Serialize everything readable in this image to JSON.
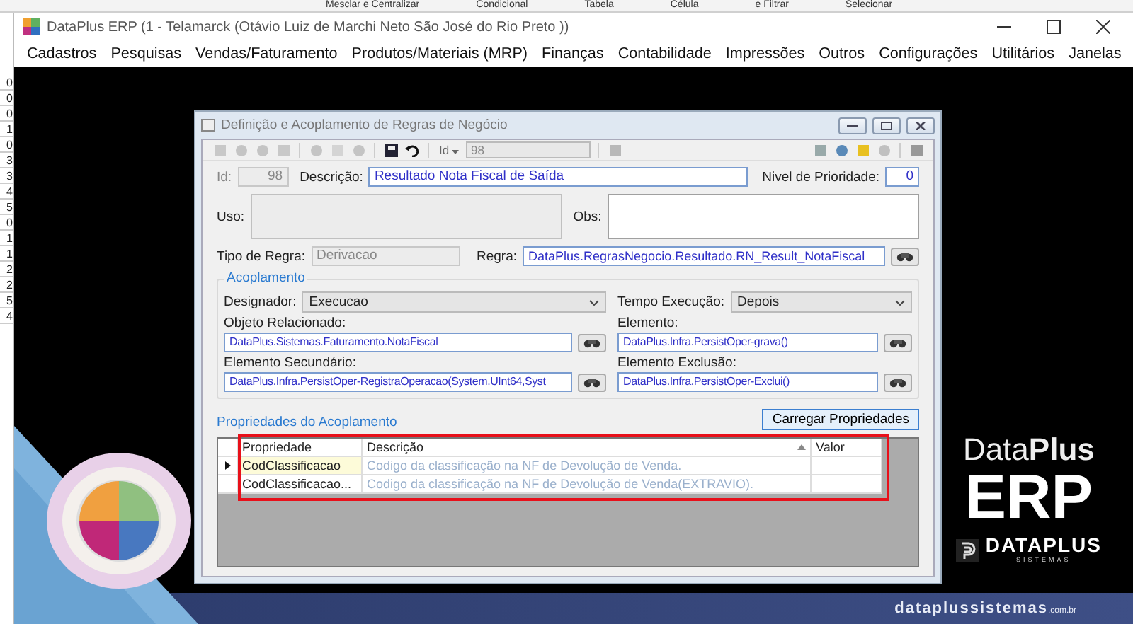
{
  "excel_ribbon": {
    "labels": [
      "Mesclar e Centralizar",
      "Condicional",
      "Tabela",
      "Célula",
      "e Filtrar",
      "Selecionar"
    ]
  },
  "excel_cells": [
    "0",
    "0",
    "0",
    "1",
    "0",
    "3",
    "3",
    "4",
    "5",
    "0",
    "1",
    "1",
    "2",
    "2",
    "5",
    "4"
  ],
  "window": {
    "title": "DataPlus ERP (1 - Telamarck  (Otávio Luiz de Marchi Neto São José do Rio Preto ))"
  },
  "menu": [
    "Cadastros",
    "Pesquisas",
    "Vendas/Faturamento",
    "Produtos/Materiais (MRP)",
    "Finanças",
    "Contabilidade",
    "Impressões",
    "Outros",
    "Configurações",
    "Utilitários",
    "Janelas"
  ],
  "dialog": {
    "title": "Definição e Acoplamento de Regras de Negócio",
    "toolbar": {
      "id_label": "Id",
      "id_value": "98"
    },
    "id": {
      "label": "Id:",
      "value": "98",
      "disabled": true
    },
    "descricao": {
      "label": "Descrição:",
      "value": "Resultado Nota Fiscal de Saída",
      "disabled": false
    },
    "prioridade": {
      "label": "Nivel de Prioridade:",
      "value": "0",
      "disabled": false
    },
    "uso": {
      "label": "Uso:",
      "disabled": true
    },
    "obs": {
      "label": "Obs:",
      "disabled": false
    },
    "tipo_regra": {
      "label": "Tipo de Regra:",
      "value": "Derivacao",
      "disabled": true
    },
    "regra": {
      "label": "Regra:",
      "value": "DataPlus.RegrasNegocio.Resultado.RN_Result_NotaFiscal",
      "disabled": false
    },
    "acoplamento": {
      "title": "Acoplamento",
      "designador": {
        "label": "Designador:",
        "value": "Execucao"
      },
      "tempo": {
        "label": "Tempo Execução:",
        "value": "Depois"
      },
      "objeto": {
        "label": "Objeto Relacionado:",
        "value": "DataPlus.Sistemas.Faturamento.NotaFiscal"
      },
      "elemento": {
        "label": "Elemento:",
        "value": "DataPlus.Infra.PersistOper-grava()"
      },
      "secundario": {
        "label": "Elemento Secundário:",
        "value": "DataPlus.Infra.PersistOper-RegistraOperacao(System.UInt64,Syst"
      },
      "exclusao": {
        "label": "Elemento Exclusão:",
        "value": "DataPlus.Infra.PersistOper-Exclui()"
      }
    },
    "load_button": "Carregar Propriedades",
    "grid": {
      "title": "Propriedades do Acoplamento",
      "columns": [
        "Propriedade",
        "Descrição",
        "Valor"
      ],
      "rows": [
        {
          "property": "CodClassificacao",
          "description": "Codigo da classificação na NF de Devolução de Venda.",
          "selected": true
        },
        {
          "property": "CodClassificacao...",
          "description": "Codigo da classificação na NF de Devolução de Venda(EXTRAVIO).",
          "selected": false
        }
      ]
    }
  },
  "brand": {
    "name_regular": "Data",
    "name_bold": "Plus",
    "product": "ERP",
    "company": "DATAPLUS",
    "company_sub": "SISTEMAS",
    "site": "dataplussistemas",
    "site_suffix": ".com.br"
  }
}
